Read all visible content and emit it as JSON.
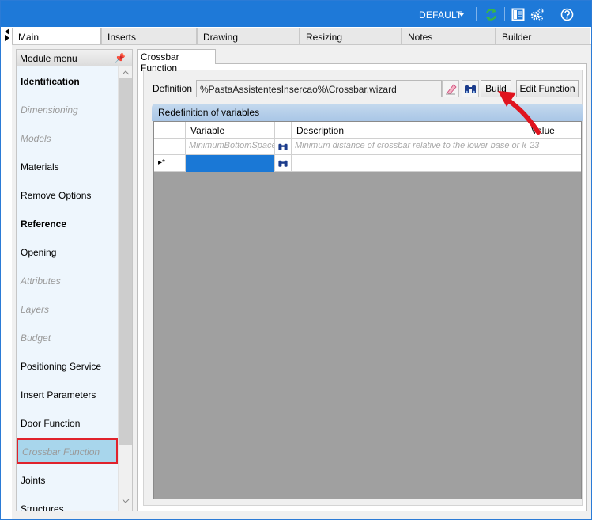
{
  "titlebar": {
    "profile": "DEFAULT",
    "icons": [
      "refresh-icon",
      "panel-icon",
      "settings-icon",
      "help-icon"
    ],
    "colors": {
      "bar": "#1e79d8",
      "refresh": "#37b54a"
    }
  },
  "tabs": [
    {
      "label": "Main",
      "active": true
    },
    {
      "label": "Inserts"
    },
    {
      "label": "Drawing"
    },
    {
      "label": "Resizing"
    },
    {
      "label": "Notes"
    },
    {
      "label": "Builder"
    }
  ],
  "module_menu": {
    "title": "Module menu",
    "items": [
      {
        "label": "Identification",
        "style": "bold"
      },
      {
        "label": "Dimensioning",
        "style": "disabled"
      },
      {
        "label": "Models",
        "style": "disabled"
      },
      {
        "label": "Materials",
        "style": "normal"
      },
      {
        "label": "Remove Options",
        "style": "normal"
      },
      {
        "label": "Reference",
        "style": "bold"
      },
      {
        "label": "Opening",
        "style": "normal"
      },
      {
        "label": "Attributes",
        "style": "disabled"
      },
      {
        "label": "Layers",
        "style": "disabled"
      },
      {
        "label": "Budget",
        "style": "disabled"
      },
      {
        "label": "Positioning Service",
        "style": "normal"
      },
      {
        "label": "Insert Parameters",
        "style": "normal"
      },
      {
        "label": "Door Function",
        "style": "normal"
      },
      {
        "label": "Crossbar Function",
        "style": "selected"
      },
      {
        "label": "Joints",
        "style": "normal"
      },
      {
        "label": "Structures",
        "style": "normal"
      }
    ]
  },
  "panel": {
    "tab_label": "Crossbar Function",
    "definition_label": "Definition",
    "definition_value": "%PastaAssistentesInsercao%\\Crossbar.wizard",
    "build_label": "Build",
    "edit_function_label": "Edit Function",
    "group_title": "Redefinition of variables",
    "columns": [
      "Variable",
      "",
      "Description",
      "Value"
    ],
    "rows": [
      {
        "variable": "MinimumBottomSpace",
        "description": "Minimum distance of crossbar relative to the lower base or left",
        "value": "23"
      }
    ],
    "new_row_marker": "▸*"
  },
  "annotation": {
    "arrow_color": "#e0141e",
    "highlight_color": "#e0222c"
  }
}
